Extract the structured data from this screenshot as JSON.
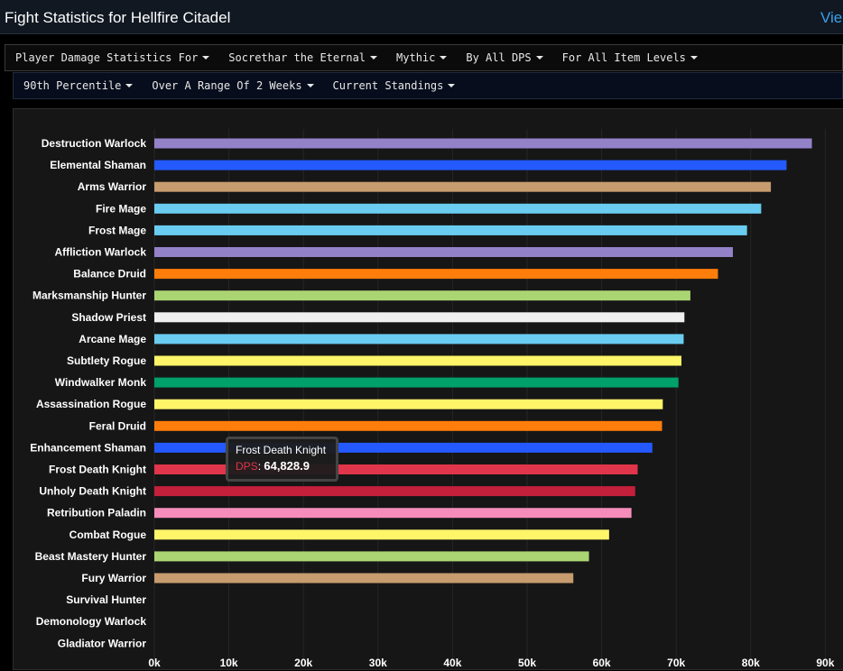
{
  "header": {
    "title": "Fight Statistics for Hellfire Citadel",
    "view_link": "Vie"
  },
  "filters": {
    "row1": [
      "Player Damage Statistics For",
      "Socrethar the Eternal",
      "Mythic",
      "By All DPS",
      "For All Item Levels"
    ],
    "row2": [
      "90th Percentile",
      "Over A Range Of 2 Weeks",
      "Current Standings"
    ]
  },
  "chart_data": {
    "type": "bar",
    "orientation": "horizontal",
    "title": "",
    "xlabel": "",
    "ylabel": "",
    "xlim": [
      0,
      90000
    ],
    "ticks": [
      "0k",
      "10k",
      "20k",
      "30k",
      "40k",
      "50k",
      "60k",
      "70k",
      "80k",
      "90k"
    ],
    "grid": true,
    "categories": [
      "Destruction Warlock",
      "Elemental Shaman",
      "Arms Warrior",
      "Fire Mage",
      "Frost Mage",
      "Affliction Warlock",
      "Balance Druid",
      "Marksmanship Hunter",
      "Shadow Priest",
      "Arcane Mage",
      "Subtlety Rogue",
      "Windwalker Monk",
      "Assassination Rogue",
      "Feral Druid",
      "Enhancement Shaman",
      "Frost Death Knight",
      "Unholy Death Knight",
      "Retribution Paladin",
      "Combat Rogue",
      "Beast Mastery Hunter",
      "Fury Warrior",
      "Survival Hunter",
      "Demonology Warlock",
      "Gladiator Warrior"
    ],
    "values": [
      88200,
      84800,
      82700,
      81400,
      79500,
      77600,
      75600,
      71900,
      71100,
      71000,
      70700,
      70300,
      68200,
      68100,
      66800,
      64828.9,
      64500,
      64000,
      61000,
      58300,
      56200,
      0,
      0,
      0
    ],
    "colors": [
      "#9482c9",
      "#2459ff",
      "#c79c6e",
      "#69ccf0",
      "#69ccf0",
      "#9482c9",
      "#ff7d0a",
      "#abd473",
      "#f0f0f0",
      "#69ccf0",
      "#fff569",
      "#00a06b",
      "#fff569",
      "#ff7d0a",
      "#2459ff",
      "#c41f3b",
      "#c41f3b",
      "#f58cba",
      "#fff569",
      "#abd473",
      "#c79c6e",
      "#abd473",
      "#9482c9",
      "#c79c6e"
    ],
    "highlight_index": 15,
    "highlight_color": "#e0354a"
  },
  "tooltip": {
    "name": "Frost Death Knight",
    "label": "DPS",
    "value": "64,828.9"
  }
}
